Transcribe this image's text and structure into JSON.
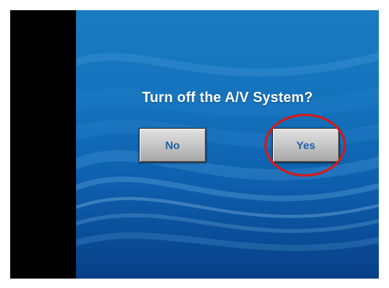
{
  "dialog": {
    "prompt": "Turn off the A/V System?",
    "no_label": "No",
    "yes_label": "Yes"
  },
  "colors": {
    "background_blue": "#1472bd",
    "button_text": "#1d5fa6",
    "highlight_ring": "#d11b1b"
  }
}
